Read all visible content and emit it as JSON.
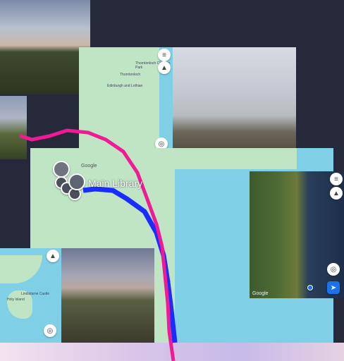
{
  "map": {
    "place_label": "Main Library",
    "attribution": "Google",
    "attribution_2": "Google",
    "attribution_3": "Google",
    "poi_1": "Thorntonloch",
    "poi_2": "Edinburgh and Lothian",
    "poi_3": "Thorntonloch Caravan Park",
    "poi_4": "Lindisfarne Castle",
    "poi_5": "Holy Island"
  },
  "icons": {
    "layers": "layers-icon",
    "compass": "compass-icon",
    "location": "my-location-icon",
    "directions": "directions-icon",
    "library": "library-icon"
  }
}
